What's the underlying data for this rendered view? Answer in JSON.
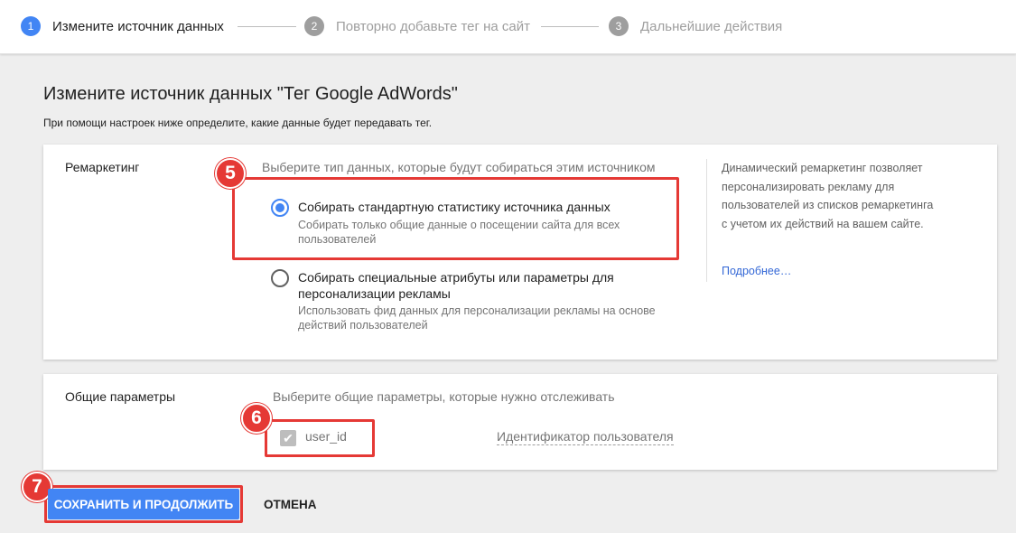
{
  "stepper": {
    "steps": [
      {
        "number": "1",
        "label": "Измените источник данных",
        "state": "active"
      },
      {
        "number": "2",
        "label": "Повторно добавьте тег на сайт",
        "state": "inactive"
      },
      {
        "number": "3",
        "label": "Дальнейшие действия",
        "state": "inactive"
      }
    ]
  },
  "page": {
    "title": "Измените источник данных \"Тег Google AdWords\"",
    "description": "При помощи настроек ниже определите, какие данные будет передавать тег."
  },
  "remarketing": {
    "label": "Ремаркетинг",
    "hint": "Выберите тип данных, которые будут собираться этим источником",
    "options": [
      {
        "title": "Собирать стандартную статистику источника данных",
        "description": "Собирать только общие данные о посещении сайта для всех пользователей",
        "checked": true
      },
      {
        "title": "Собирать специальные атрибуты или параметры для персонализации рекламы",
        "description": "Использовать фид данных для персонализации рекламы на основе действий пользователей",
        "checked": false
      }
    ],
    "side_text": "Динамический ремаркетинг позволяет персонализировать рекламу для пользователей из списков ремаркетинга с учетом их действий на вашем сайте.",
    "side_link": "Подробнее…"
  },
  "general": {
    "label": "Общие параметры",
    "hint": "Выберите общие параметры, которые нужно отслеживать",
    "param_name": "user_id",
    "param_description": "Идентификатор пользователя",
    "param_checked": true,
    "param_disabled": true
  },
  "annotations": {
    "badge_5": "5",
    "badge_6": "6",
    "badge_7": "7"
  },
  "actions": {
    "save_label": "СОХРАНИТЬ И ПРОДОЛЖИТЬ",
    "cancel_label": "ОТМЕНА"
  },
  "colors": {
    "accent": "#4285f4",
    "highlight": "#e53935",
    "inactive": "#9e9e9e"
  }
}
